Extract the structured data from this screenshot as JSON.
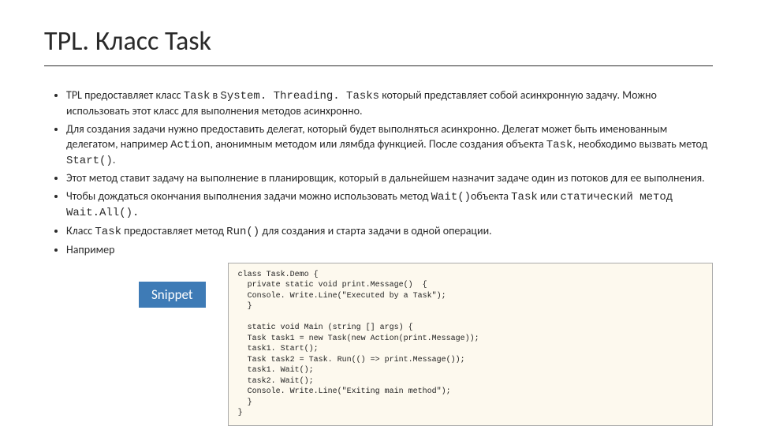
{
  "title": "TPL. Класс Task",
  "bullets": [
    {
      "pre": "TPL предоставляет класс ",
      "c1": "Task",
      "mid1": " в ",
      "c2": "System. Threading. Tasks",
      "post": " который представляет собой асинхронную задачу. Можно использовать этот класс для выполнения методов асинхронно."
    },
    {
      "text": "Для создания задачи нужно предоставить делегат, который будет выполняться асинхронно. Делегат может быть именованным делегатом, например ",
      "c1": "Action",
      "mid": ", анонимным методом или лямбда функцией. После создания объекта ",
      "c2": "Task",
      "mid2": ", необходимо вызвать метод ",
      "c3": "Start()",
      "post": "."
    },
    {
      "text": "Этот метод ставит задачу на выполнение в планировщик, который в дальнейшем назначит задаче один из потоков для ее выполнения."
    },
    {
      "text": "Чтобы дождаться окончания выполнения задачи можно использовать метод ",
      "c1": "Wait()",
      "mid": "объекта ",
      "c2": "Task",
      "mid2": "  или ",
      "c3": "статический метод Wait.All()."
    },
    {
      "text": "Класс ",
      "c1": "Task",
      "mid": " предоставляет метод ",
      "c2": "Run()",
      "post": " для создания и старта задачи в одной операции."
    },
    {
      "text": "Например"
    }
  ],
  "snippet_label": "Snippet",
  "code": "class Task.Demo {\n  private static void print.Message()  {\n  Console. Write.Line(\"Executed by a Task\");\n  }\n\n  static void Main (string [] args) {\n  Task task1 = new Task(new Action(print.Message));\n  task1. Start();\n  Task task2 = Task. Run(() => print.Message());\n  task1. Wait();\n  task2. Wait();\n  Console. Write.Line(\"Exiting main method\");\n  }\n}"
}
